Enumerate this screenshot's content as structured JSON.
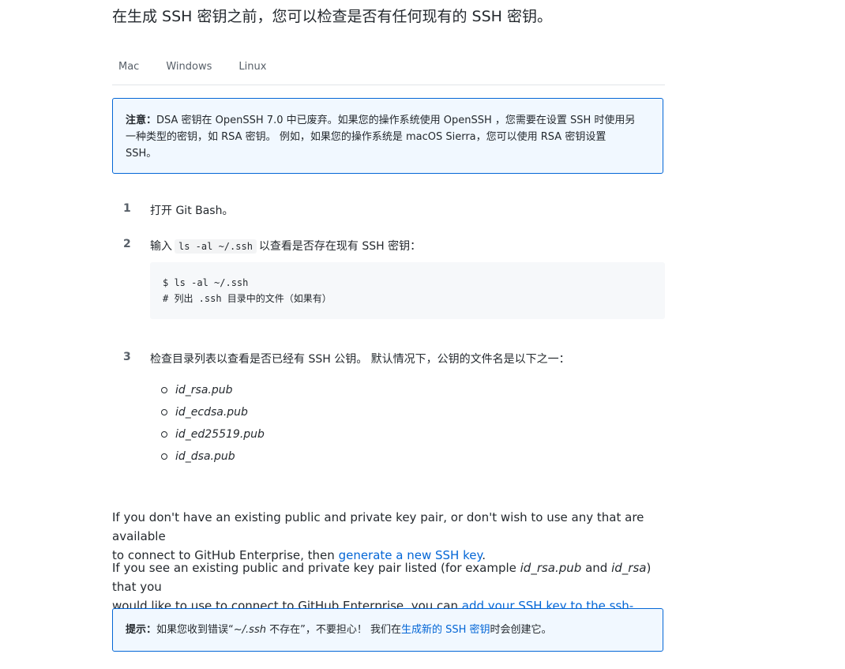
{
  "intro": "在生成 SSH 密钥之前，您可以检查是否有任何现有的 SSH 密钥。",
  "tabs": [
    {
      "label": "Mac"
    },
    {
      "label": "Windows"
    },
    {
      "label": "Linux"
    }
  ],
  "note1": {
    "bold": "注意：",
    "line1": "DSA 密钥在 OpenSSH 7.0 中已废弃。如果您的操作系统使用 OpenSSH ，您需要在设置 SSH 时使用另",
    "line2": "一种类型的密钥，如 RSA 密钥。 例如，如果您的操作系统是 macOS Sierra，您可以使用 RSA 密钥设置",
    "line3": "SSH。"
  },
  "steps": [
    {
      "num": "1",
      "text": "打开 Git Bash。"
    },
    {
      "num": "2",
      "before": "输入",
      "code": "ls -al ~/.ssh",
      "after": "以查看是否存在现有 SSH 密钥："
    },
    {
      "num": "3",
      "text": "检查目录列表以查看是否已经有 SSH 公钥。 默认情况下，公钥的文件名是以下之一："
    }
  ],
  "code": {
    "line1": "$ ls -al ~/.ssh",
    "line2": "# 列出 .ssh 目录中的文件（如果有）"
  },
  "files": [
    "id_rsa.pub",
    "id_ecdsa.pub",
    "id_ed25519.pub",
    "id_dsa.pub"
  ],
  "para1": {
    "text1": "If you don't have an existing public and private key pair, or don't wish to use any that are available",
    "text2": "to connect to GitHub Enterprise, then ",
    "link": "generate a new SSH key",
    "end": "."
  },
  "para2": {
    "text1": "If you see an existing public and private key pair listed (for example ",
    "em1": "id_rsa.pub",
    "and": " and ",
    "em2": "id_rsa",
    "text2": ") that you",
    "text3": "would like to use to connect to GitHub Enterprise, you can ",
    "link": "add your SSH key to the ssh-agent",
    "end": "."
  },
  "note2": {
    "bold": "提示：",
    "text1": "如果您收到错误“",
    "em": "~/.ssh",
    "text2": " 不存在”，不要担心！ 我们在",
    "link": "生成新的 SSH 密钥",
    "text3": "时会创建它。"
  },
  "colors": {
    "link": "#0366d6",
    "note_border": "#0366d6",
    "note_bg": "#f1f8ff",
    "code_bg": "#f6f8fa"
  }
}
